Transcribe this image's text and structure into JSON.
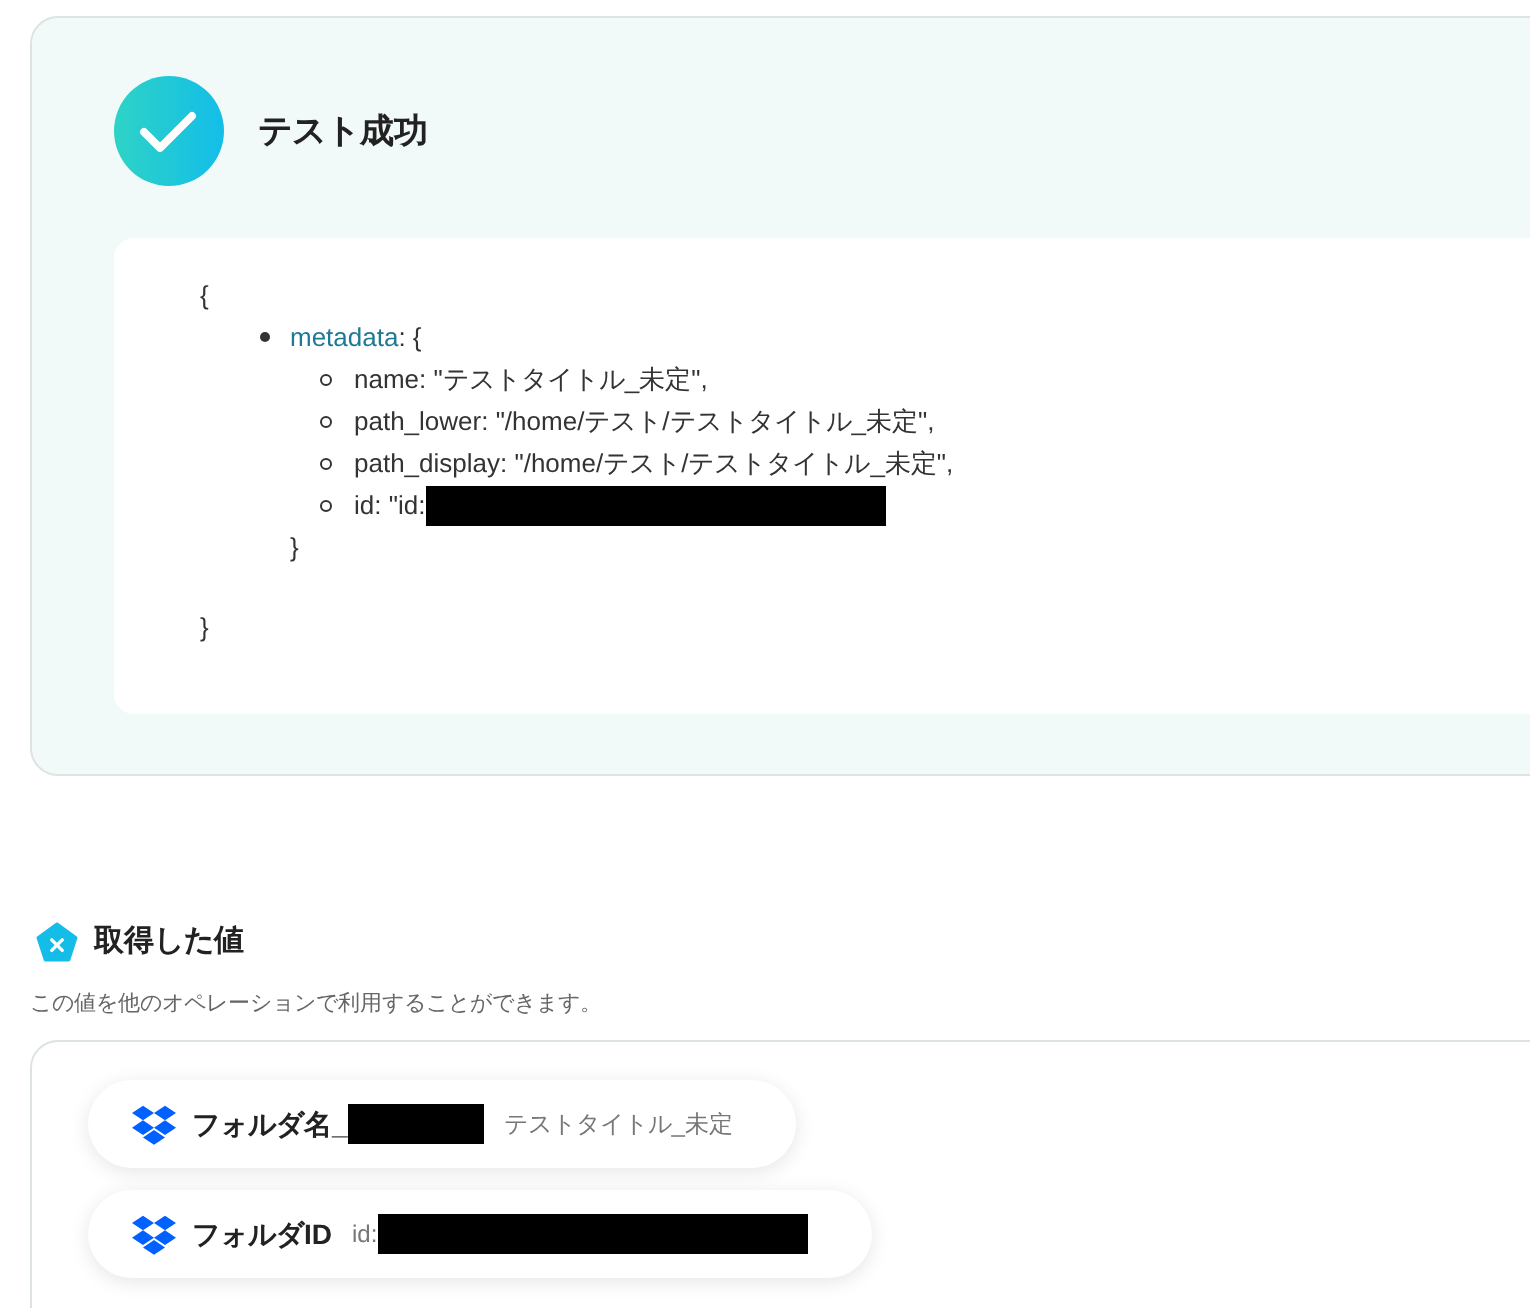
{
  "result": {
    "title": "テスト成功",
    "open": "{",
    "close": "}",
    "items": [
      {
        "key": "metadata",
        "open": ": {",
        "close": "}",
        "children": [
          {
            "text": "name: \"テストタイトル_未定\",",
            "redacted": false
          },
          {
            "text": "path_lower: \"/home/テスト/テストタイトル_未定\",",
            "redacted": false
          },
          {
            "text": "path_display: \"/home/テスト/テストタイトル_未定\",",
            "redacted": false
          },
          {
            "text": "id: \"id:",
            "redacted": true
          }
        ]
      }
    ]
  },
  "outputs": {
    "title": "取得した値",
    "description": "この値を他のオペレーションで利用することができます。",
    "values": [
      {
        "label": "フォルダ名_",
        "label_redacted": true,
        "value": "テストタイトル_未定",
        "value_redacted": false
      },
      {
        "label": "フォルダID",
        "label_redacted": false,
        "value": "id:",
        "value_redacted": true
      }
    ]
  }
}
